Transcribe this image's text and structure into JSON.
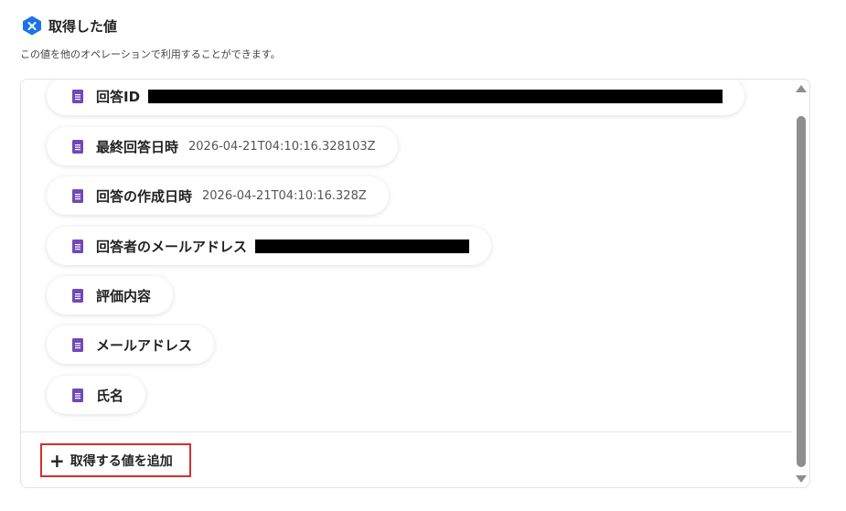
{
  "header": {
    "title": "取得した値",
    "logo_icon": "yoom-logo-icon",
    "logo_color": "#1a73e8"
  },
  "description": "この値を他のオペレーションで利用することができます。",
  "fields": [
    {
      "label": "回答ID",
      "value": "",
      "redacted": true
    },
    {
      "label": "最終回答日時",
      "value": "2026-04-21T04:10:16.328103Z",
      "redacted": false
    },
    {
      "label": "回答の作成日時",
      "value": "2026-04-21T04:10:16.328Z",
      "redacted": false
    },
    {
      "label": "回答者のメールアドレス",
      "value": "",
      "redacted": true
    },
    {
      "label": "評価内容",
      "value": "",
      "redacted": false
    },
    {
      "label": "メールアドレス",
      "value": "",
      "redacted": false
    },
    {
      "label": "氏名",
      "value": "",
      "redacted": false
    }
  ],
  "field_icon": "google-forms-document-icon",
  "field_icon_color": "#7248b9",
  "add_button": {
    "label": "取得する値を追加",
    "icon": "plus-icon",
    "highlight_color": "#d32f2f"
  }
}
